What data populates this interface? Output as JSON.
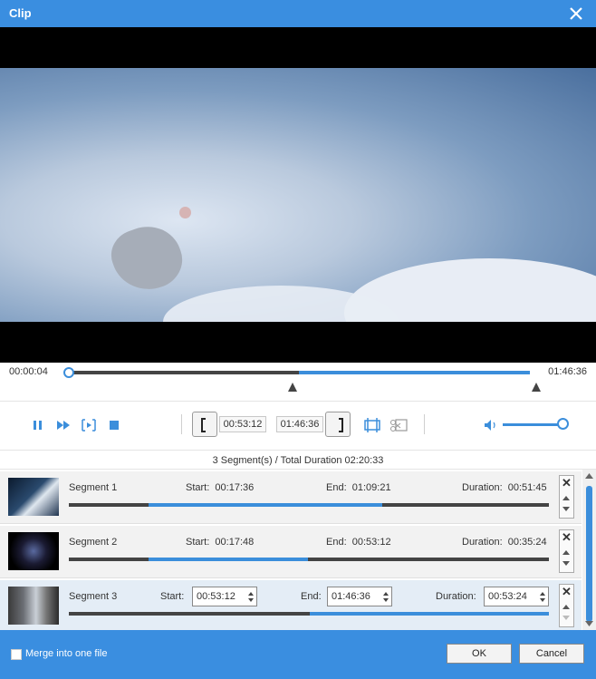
{
  "window": {
    "title": "Clip"
  },
  "player": {
    "current_time": "00:00:04",
    "total_time": "01:46:36",
    "progress_fraction": 0.0,
    "selection_start_fraction": 0.5,
    "selection_end_fraction": 1.0
  },
  "controls": {
    "start_time": "00:53:12",
    "end_time": "01:46:36",
    "volume_fraction": 0.9
  },
  "summary": "3 Segment(s) / Total Duration 02:20:33",
  "segments": [
    {
      "name": "Segment 1",
      "start_label": "Start:",
      "start": "00:17:36",
      "end_label": "End:",
      "end": "01:09:21",
      "duration_label": "Duration:",
      "duration": "00:51:45"
    },
    {
      "name": "Segment 2",
      "start_label": "Start:",
      "start": "00:17:48",
      "end_label": "End:",
      "end": "00:53:12",
      "duration_label": "Duration:",
      "duration": "00:35:24"
    },
    {
      "name": "Segment 3",
      "start_label": "Start:",
      "start": "00:53:12",
      "end_label": "End:",
      "end": "01:46:36",
      "duration_label": "Duration:",
      "duration": "00:53:24"
    }
  ],
  "footer": {
    "merge_label": "Merge into one file",
    "ok_label": "OK",
    "cancel_label": "Cancel"
  },
  "colors": {
    "accent": "#3a8ee0",
    "track": "#444444",
    "fill": "#3b8edb"
  }
}
